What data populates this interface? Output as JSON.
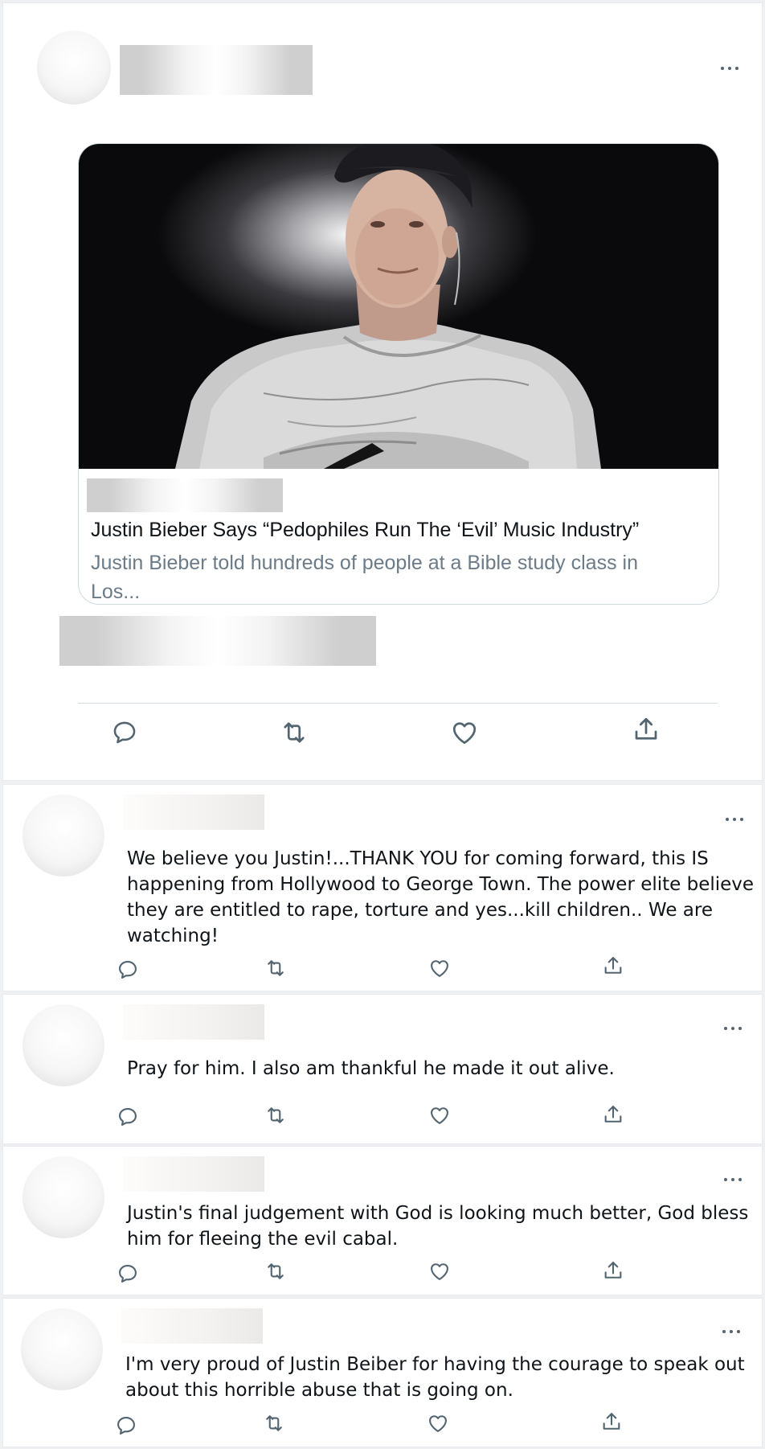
{
  "main_tweet": {
    "link_card": {
      "title": "Justin Bieber Says “Pedophiles Run The ‘Evil’ Music Industry”",
      "description": "Justin Bieber told hundreds of people at a Bible study class in Los..."
    },
    "actions": [
      "reply-icon",
      "retweet-icon",
      "like-icon",
      "share-icon"
    ]
  },
  "replies": [
    {
      "text": "We believe you Justin!...THANK YOU for coming forward, this IS happening from Hollywood to George Town. The power elite believe they are entitled to rape, torture and yes...kill children.. We are watching!"
    },
    {
      "text": "Pray for him. I also am thankful he made it out alive."
    },
    {
      "text": "Justin's final judgement with God is looking much better, God bless him for fleeing the evil cabal."
    },
    {
      "text": "I'm very proud of Justin Beiber for having the courage to speak out about this horrible abuse that is going on."
    }
  ],
  "colors": {
    "text": "#0f1419",
    "muted": "#536471",
    "border": "#cfd9de",
    "background": "#eef0f2"
  }
}
